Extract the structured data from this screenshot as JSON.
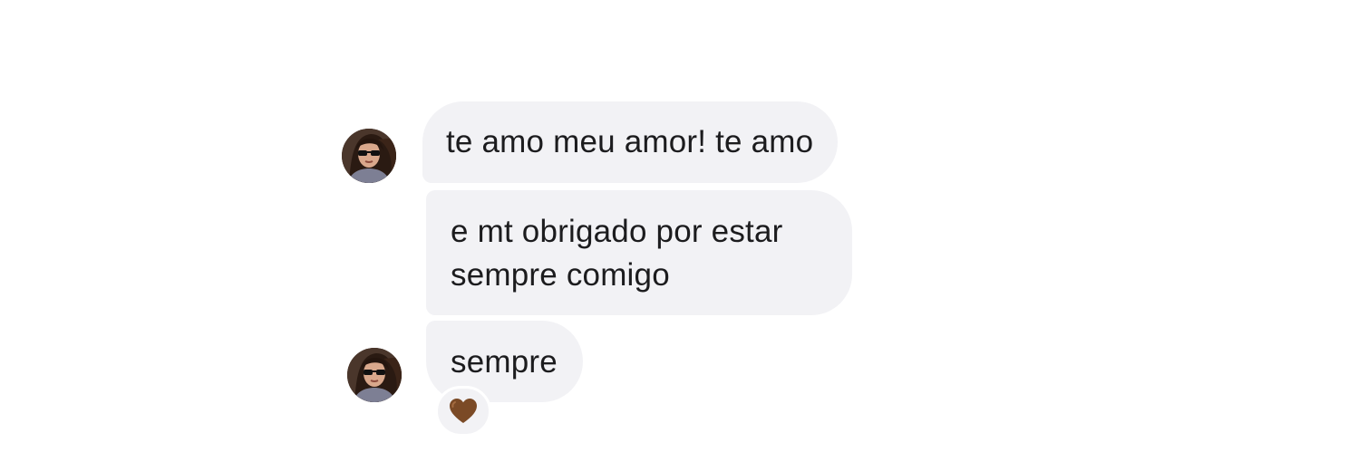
{
  "conversation": {
    "messages": [
      {
        "text": "te amo meu amor! te amo"
      },
      {
        "text": "e mt obrigado por estar sempre comigo"
      },
      {
        "text": "sempre"
      }
    ],
    "reaction": {
      "icon": "brown-heart-icon",
      "color": "#7b4a26"
    },
    "colors": {
      "bubble": "#f2f2f5",
      "text": "#1c1c1e",
      "background": "#ffffff"
    }
  }
}
